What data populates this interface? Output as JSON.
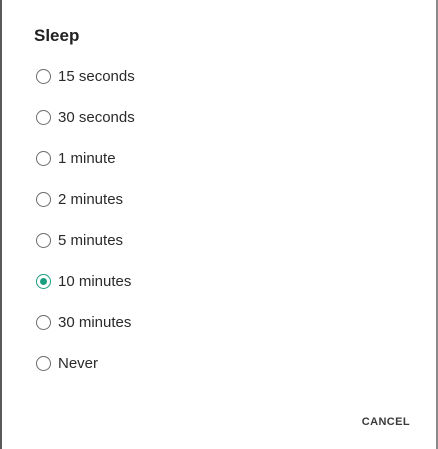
{
  "dialog": {
    "title": "Sleep",
    "options": [
      {
        "label": "15 seconds",
        "selected": false
      },
      {
        "label": "30 seconds",
        "selected": false
      },
      {
        "label": "1 minute",
        "selected": false
      },
      {
        "label": "2 minutes",
        "selected": false
      },
      {
        "label": "5 minutes",
        "selected": false
      },
      {
        "label": "10 minutes",
        "selected": true
      },
      {
        "label": "30 minutes",
        "selected": false
      },
      {
        "label": "Never",
        "selected": false
      }
    ],
    "cancel_label": "CANCEL"
  },
  "colors": {
    "accent": "#1a9e7e",
    "radio_border": "#6b6b6b",
    "text": "#2a2a2a"
  }
}
